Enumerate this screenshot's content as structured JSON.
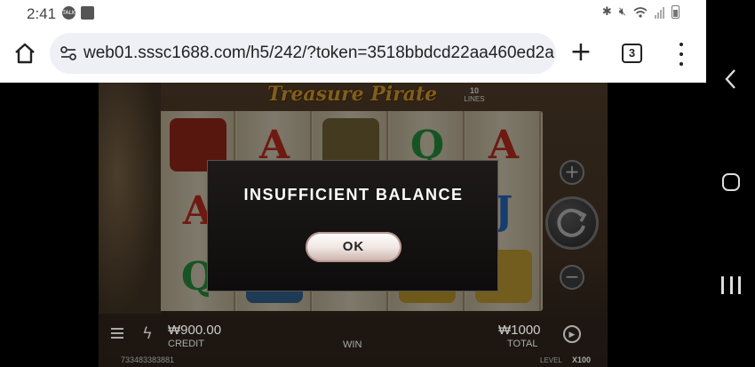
{
  "status_bar": {
    "time": "2:41",
    "left_icons": [
      "talk-notification-icon",
      "image-notification-icon"
    ],
    "right_icons": [
      "bluetooth-icon",
      "mute-icon",
      "wifi-icon",
      "signal-icon",
      "battery-icon"
    ]
  },
  "browser": {
    "url": "web01.sssc1688.com/h5/242/?token=3518bbdcd22aa460ed2a",
    "tab_count": "3"
  },
  "game": {
    "title": "Treasure Pirate",
    "lines_number": "10",
    "lines_label": "LINES",
    "credit_value": "₩900.00",
    "credit_label": "CREDIT",
    "win_label": "WIN",
    "total_value": "₩1000",
    "total_label": "TOTAL",
    "player_id": "733483383881",
    "level_label": "LEVEL",
    "level_value": "X100",
    "plus_label": "+",
    "minus_label": "−"
  },
  "modal": {
    "message": "INSUFFICIENT BALANCE",
    "ok_label": "OK"
  },
  "colors": {
    "modal_bg": "#141010",
    "ok_button": "#f1e8e4",
    "browser_bar": "#ffffff",
    "url_field": "#eef0f5"
  }
}
